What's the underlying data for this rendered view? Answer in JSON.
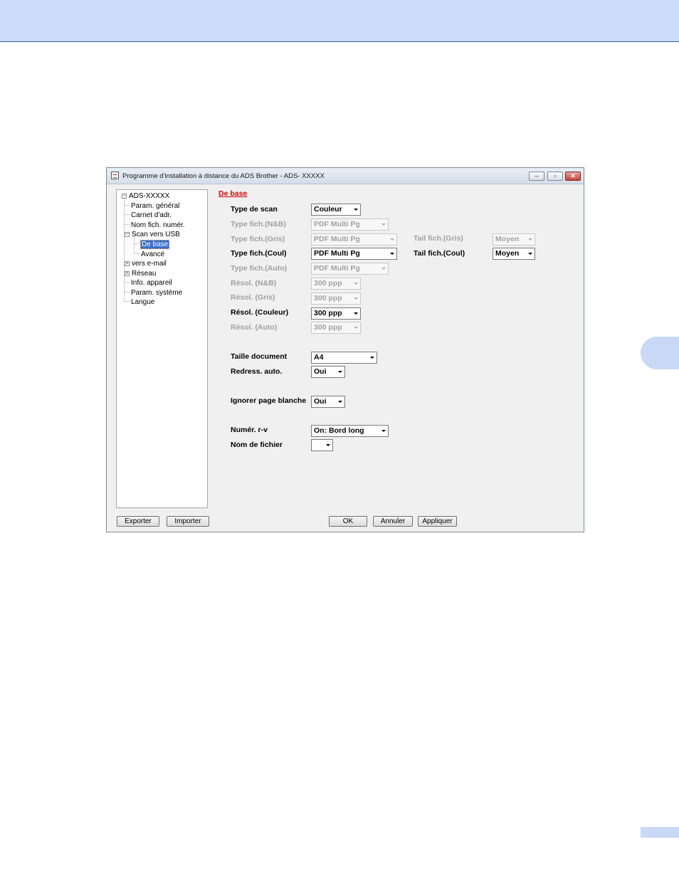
{
  "window": {
    "title": "Programme d'installation à distance du ADS Brother - ADS- XXXXX",
    "minimize": "–",
    "maximize": "▫",
    "close": "✕"
  },
  "tree": {
    "root": "ADS-XXXXX",
    "items": [
      {
        "label": "Param. général"
      },
      {
        "label": "Carnet d'adr."
      },
      {
        "label": "Nom fich. numér."
      },
      {
        "label": "Scan vers USB"
      },
      {
        "label": "De base"
      },
      {
        "label": "Avancé"
      },
      {
        "label": "vers e-mail"
      },
      {
        "label": "Réseau"
      },
      {
        "label": "Info. appareil"
      },
      {
        "label": "Param. système"
      },
      {
        "label": "Langue"
      }
    ]
  },
  "section_title": "De base",
  "fields": {
    "scan_type": {
      "label": "Type de scan",
      "value": "Couleur"
    },
    "file_type_bw": {
      "label": "Type fich.(N&B)",
      "value": "PDF Multi Pg"
    },
    "file_type_gray": {
      "label": "Type fich.(Gris)",
      "value": "PDF Multi Pg"
    },
    "file_size_gray": {
      "label": "Tail fich.(Gris)",
      "value": "Moyen"
    },
    "file_type_color": {
      "label": "Type fich.(Coul)",
      "value": "PDF Multi Pg"
    },
    "file_size_color": {
      "label": "Tail fich.(Coul)",
      "value": "Moyen"
    },
    "file_type_auto": {
      "label": "Type fich.(Auto)",
      "value": "PDF Multi Pg"
    },
    "res_bw": {
      "label": "Résol. (N&B)",
      "value": "300 ppp"
    },
    "res_gray": {
      "label": "Résol. (Gris)",
      "value": "300 ppp"
    },
    "res_color": {
      "label": "Résol. (Couleur)",
      "value": "300 ppp"
    },
    "res_auto": {
      "label": "Résol. (Auto)",
      "value": "300 ppp"
    },
    "doc_size": {
      "label": "Taille document",
      "value": "A4"
    },
    "auto_deskew": {
      "label": "Redress. auto.",
      "value": "Oui"
    },
    "skip_blank": {
      "label": "Ignorer page blanche",
      "value": "Oui"
    },
    "duplex": {
      "label": "Numér. r-v",
      "value": "On: Bord long"
    },
    "file_name": {
      "label": "Nom de fichier",
      "value": ""
    }
  },
  "buttons": {
    "export": "Exporter",
    "import": "Importer",
    "ok": "OK",
    "cancel": "Annuler",
    "apply": "Appliquer"
  }
}
